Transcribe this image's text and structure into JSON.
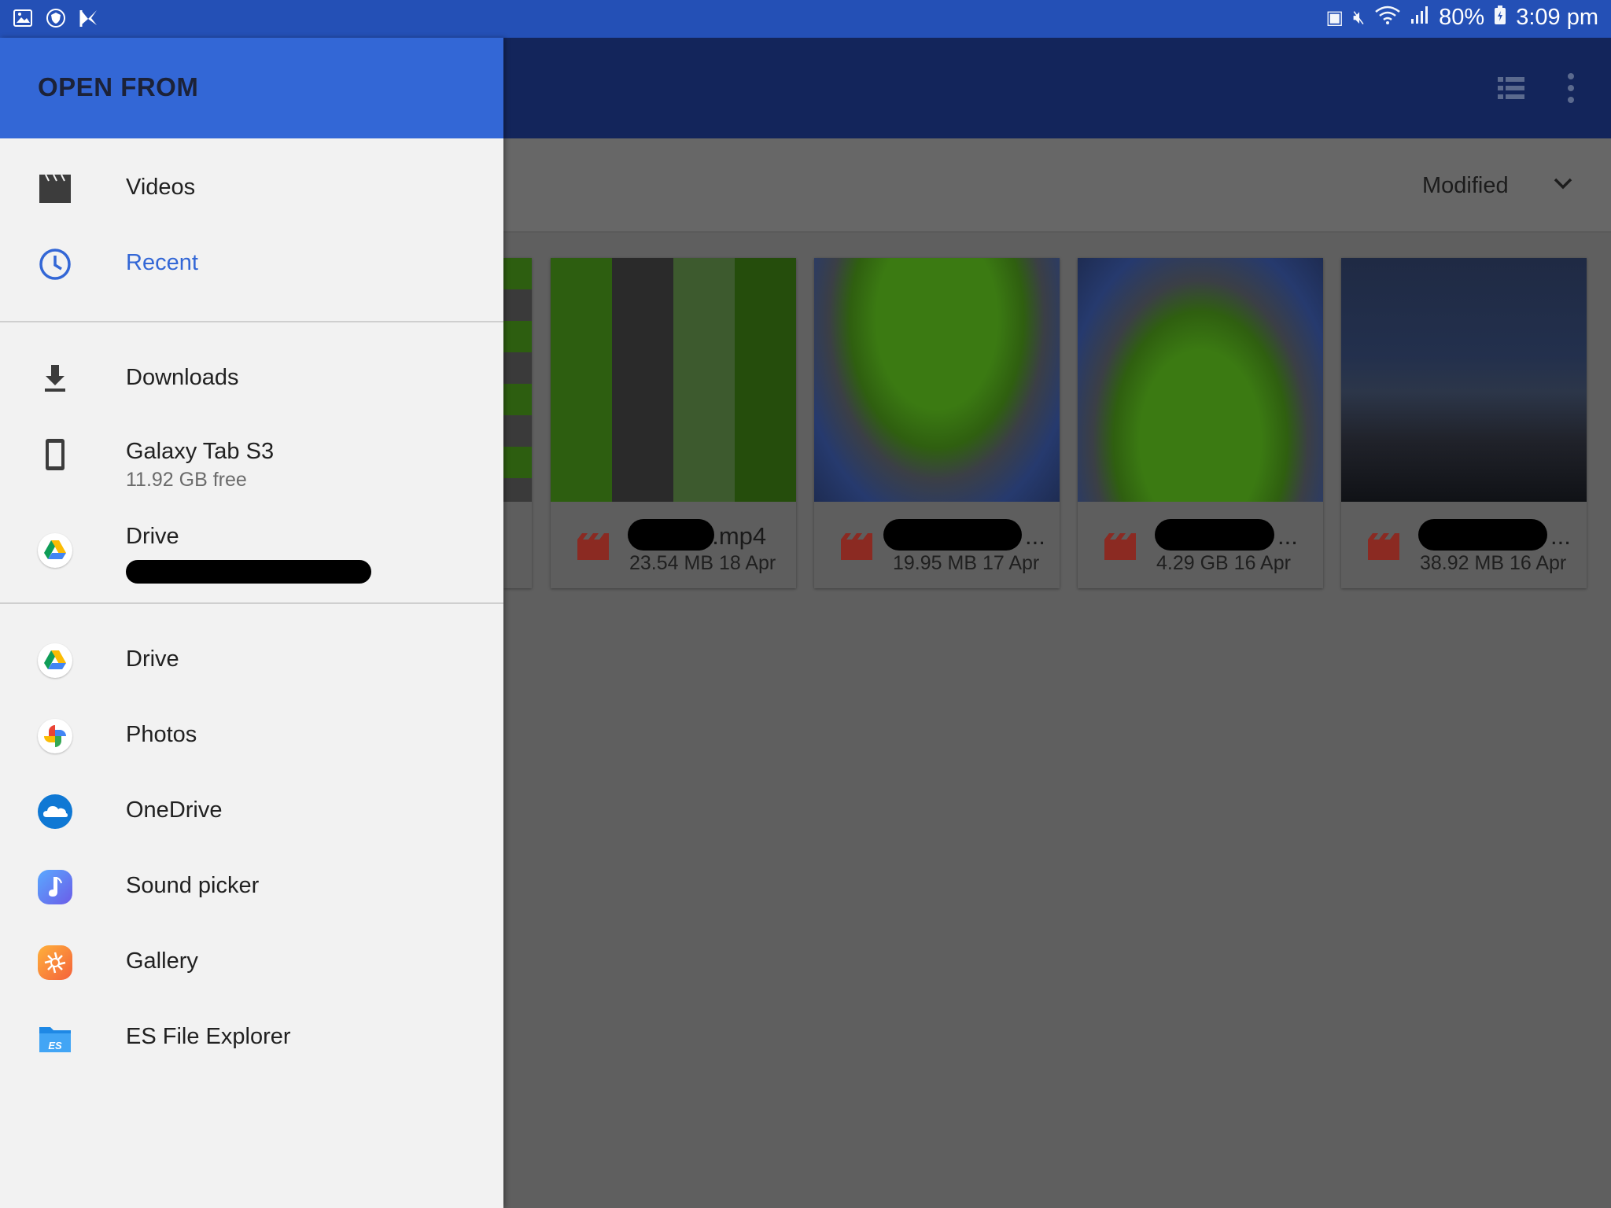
{
  "status_bar": {
    "battery": "80%",
    "time": "3:09 pm"
  },
  "drawer": {
    "title": "OPEN FROM",
    "section1": [
      {
        "label": "Videos",
        "icon": "video-clapper-icon"
      },
      {
        "label": "Recent",
        "icon": "clock-icon"
      }
    ],
    "section2": [
      {
        "label": "Downloads",
        "icon": "download-icon"
      },
      {
        "label": "Galaxy Tab S3",
        "sub": "11.92 GB free",
        "icon": "tablet-icon"
      },
      {
        "label": "Drive",
        "icon": "google-drive-icon"
      }
    ],
    "section3": [
      {
        "label": "Drive",
        "icon": "google-drive-icon"
      },
      {
        "label": "Photos",
        "icon": "google-photos-icon"
      },
      {
        "label": "OneDrive",
        "icon": "onedrive-icon"
      },
      {
        "label": "Sound picker",
        "icon": "sound-picker-icon"
      },
      {
        "label": "Gallery",
        "icon": "gallery-icon"
      },
      {
        "label": "ES File Explorer",
        "icon": "es-file-explorer-icon"
      }
    ]
  },
  "background": {
    "sort_label": "Modified",
    "files": [
      {
        "name": "o.mp4",
        "meta": "23.54 MB 18 Apr"
      },
      {
        "name": "...",
        "meta": "19.95 MB 17 Apr"
      },
      {
        "name": "...",
        "meta": "4.29 GB 16 Apr"
      },
      {
        "name": "...",
        "meta": "38.92 MB 16 Apr"
      }
    ]
  },
  "colors": {
    "status_bar": "#2450b6",
    "drawer_header": "#3367d6",
    "active": "#3367d6",
    "app_bar_dimmed": "#13255b"
  }
}
